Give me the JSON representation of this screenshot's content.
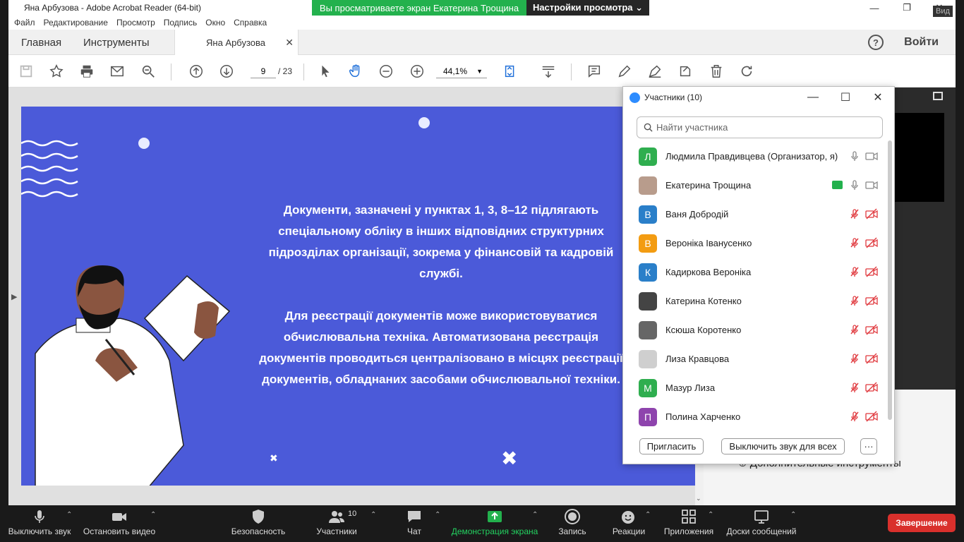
{
  "window": {
    "title": "Яна Арбузова - Adobe Acrobat Reader (64-bit)",
    "menu": [
      "Файл",
      "Редактирование",
      "Просмотр",
      "Подпись",
      "Окно",
      "Справка"
    ]
  },
  "tabs": {
    "home": "Главная",
    "tools": "Инструменты",
    "doc": "Яна Арбузова",
    "login": "Войти",
    "help": "?"
  },
  "toolbar": {
    "page_current": "9",
    "page_total": "/ 23",
    "zoom": "44,1%"
  },
  "slide": {
    "paragraph1": "Документи, зазначені у пунктах 1, 3, 8–12 підлягають спеціальному обліку в інших відповідних структурних підрозділах організації, зокрема у фінансовій та кадровій службі.",
    "paragraph2": "Для реєстрації документів може використовуватися обчислювальна техніка. Автоматизована реєстрація документів проводиться централізовано в місцях реєстрації документів, обладнаних засобами обчислювальної техніки."
  },
  "right_panel": {
    "more_tools": "Дополнительные инструменты",
    "view_label": "Вид"
  },
  "zoom_banner": {
    "viewing": "Вы просматриваете экран Екатерина Трощина",
    "settings": "Настройки просмотра ⌄"
  },
  "participants": {
    "title": "Участники (10)",
    "search_placeholder": "Найти участника",
    "list": [
      {
        "initial": "Л",
        "name": "Людмила Правдивцева (Организатор, я)",
        "color": "#2fae4f",
        "muted": false
      },
      {
        "initial": "",
        "name": "Екатерина Трощина",
        "color": "#b89c8c",
        "muted": false
      },
      {
        "initial": "В",
        "name": "Ваня Добродій",
        "color": "#2a7fc9",
        "muted": true
      },
      {
        "initial": "В",
        "name": "Вероніка Іванусенко",
        "color": "#f39c12",
        "muted": true
      },
      {
        "initial": "К",
        "name": "Кадиркова Вероніка",
        "color": "#2a7fc9",
        "muted": true
      },
      {
        "initial": "",
        "name": "Катерина Котенко",
        "color": "#444444",
        "muted": true
      },
      {
        "initial": "",
        "name": "Ксюша Коротенко",
        "color": "#666666",
        "muted": true
      },
      {
        "initial": "",
        "name": "Лиза Кравцова",
        "color": "#cfcfcf",
        "muted": true
      },
      {
        "initial": "М",
        "name": "Мазур Лиза",
        "color": "#2fae4f",
        "muted": true
      },
      {
        "initial": "П",
        "name": "Полина Харченко",
        "color": "#8e44ad",
        "muted": true
      }
    ],
    "invite": "Пригласить",
    "mute_all": "Выключить звук для всех",
    "more": "···"
  },
  "zoom_bar": {
    "mute": "Выключить звук",
    "video": "Остановить видео",
    "security": "Безопасность",
    "participants": "Участники",
    "participants_count": "10",
    "chat": "Чат",
    "share": "Демонстрация экрана",
    "record": "Запись",
    "reactions": "Реакции",
    "apps": "Приложения",
    "whiteboards": "Доски сообщений",
    "end": "Завершение"
  },
  "colors": {
    "slide_bg": "#4b5ad9",
    "zoom_green": "#23b14d",
    "end_red": "#d9302c"
  }
}
